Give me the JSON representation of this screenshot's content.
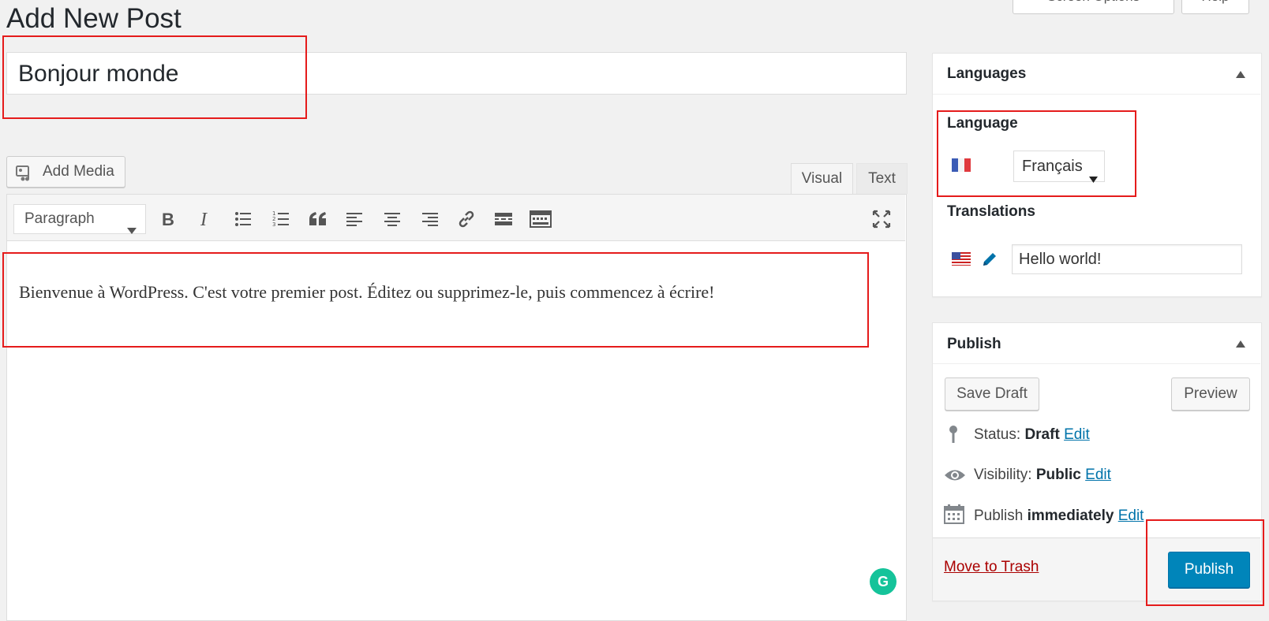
{
  "page": {
    "title": "Add New Post"
  },
  "top_buttons": {
    "screen_options": "Screen Options",
    "help": "Help"
  },
  "post": {
    "title_value": "Bonjour monde",
    "content": "Bienvenue à WordPress. C'est votre premier post. Éditez ou supprimez-le, puis commencez à écrire!"
  },
  "editor": {
    "add_media": "Add Media",
    "tab_visual": "Visual",
    "tab_text": "Text",
    "format_select": "Paragraph"
  },
  "languages_box": {
    "title": "Languages",
    "language_label": "Language",
    "language_value": "Français",
    "translations_label": "Translations",
    "translation_value": "Hello world!"
  },
  "publish_box": {
    "title": "Publish",
    "save_draft": "Save Draft",
    "preview": "Preview",
    "status_label": "Status:",
    "status_value": "Draft",
    "visibility_label": "Visibility:",
    "visibility_value": "Public",
    "publish_label": "Publish",
    "publish_value": "immediately",
    "edit_link": "Edit",
    "move_to_trash": "Move to Trash",
    "publish_button": "Publish"
  },
  "colors": {
    "accent": "#0085ba",
    "highlight": "#e51b1b",
    "link": "#0073aa",
    "trash": "#aa0000"
  }
}
